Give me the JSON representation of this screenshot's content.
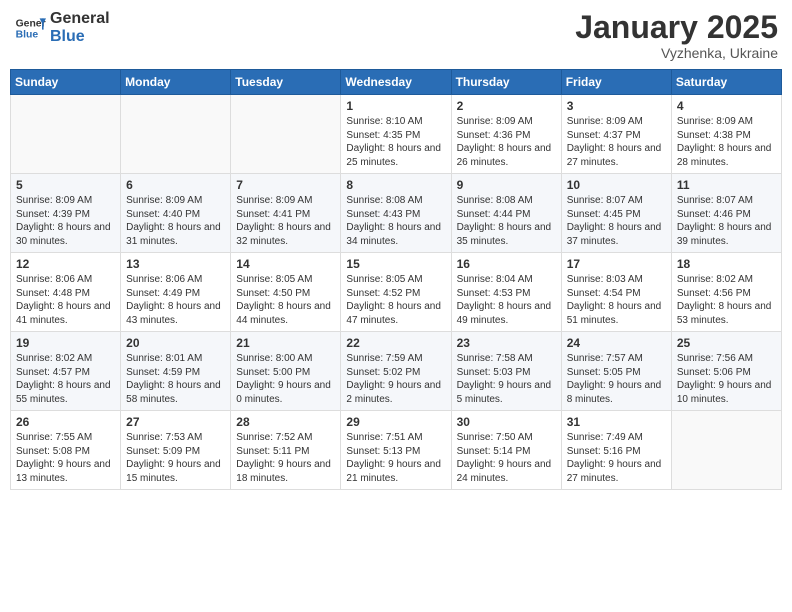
{
  "logo": {
    "line1": "General",
    "line2": "Blue"
  },
  "title": "January 2025",
  "subtitle": "Vyzhenka, Ukraine",
  "weekdays": [
    "Sunday",
    "Monday",
    "Tuesday",
    "Wednesday",
    "Thursday",
    "Friday",
    "Saturday"
  ],
  "weeks": [
    [
      {
        "day": "",
        "info": ""
      },
      {
        "day": "",
        "info": ""
      },
      {
        "day": "",
        "info": ""
      },
      {
        "day": "1",
        "info": "Sunrise: 8:10 AM\nSunset: 4:35 PM\nDaylight: 8 hours and 25 minutes."
      },
      {
        "day": "2",
        "info": "Sunrise: 8:09 AM\nSunset: 4:36 PM\nDaylight: 8 hours and 26 minutes."
      },
      {
        "day": "3",
        "info": "Sunrise: 8:09 AM\nSunset: 4:37 PM\nDaylight: 8 hours and 27 minutes."
      },
      {
        "day": "4",
        "info": "Sunrise: 8:09 AM\nSunset: 4:38 PM\nDaylight: 8 hours and 28 minutes."
      }
    ],
    [
      {
        "day": "5",
        "info": "Sunrise: 8:09 AM\nSunset: 4:39 PM\nDaylight: 8 hours and 30 minutes."
      },
      {
        "day": "6",
        "info": "Sunrise: 8:09 AM\nSunset: 4:40 PM\nDaylight: 8 hours and 31 minutes."
      },
      {
        "day": "7",
        "info": "Sunrise: 8:09 AM\nSunset: 4:41 PM\nDaylight: 8 hours and 32 minutes."
      },
      {
        "day": "8",
        "info": "Sunrise: 8:08 AM\nSunset: 4:43 PM\nDaylight: 8 hours and 34 minutes."
      },
      {
        "day": "9",
        "info": "Sunrise: 8:08 AM\nSunset: 4:44 PM\nDaylight: 8 hours and 35 minutes."
      },
      {
        "day": "10",
        "info": "Sunrise: 8:07 AM\nSunset: 4:45 PM\nDaylight: 8 hours and 37 minutes."
      },
      {
        "day": "11",
        "info": "Sunrise: 8:07 AM\nSunset: 4:46 PM\nDaylight: 8 hours and 39 minutes."
      }
    ],
    [
      {
        "day": "12",
        "info": "Sunrise: 8:06 AM\nSunset: 4:48 PM\nDaylight: 8 hours and 41 minutes."
      },
      {
        "day": "13",
        "info": "Sunrise: 8:06 AM\nSunset: 4:49 PM\nDaylight: 8 hours and 43 minutes."
      },
      {
        "day": "14",
        "info": "Sunrise: 8:05 AM\nSunset: 4:50 PM\nDaylight: 8 hours and 44 minutes."
      },
      {
        "day": "15",
        "info": "Sunrise: 8:05 AM\nSunset: 4:52 PM\nDaylight: 8 hours and 47 minutes."
      },
      {
        "day": "16",
        "info": "Sunrise: 8:04 AM\nSunset: 4:53 PM\nDaylight: 8 hours and 49 minutes."
      },
      {
        "day": "17",
        "info": "Sunrise: 8:03 AM\nSunset: 4:54 PM\nDaylight: 8 hours and 51 minutes."
      },
      {
        "day": "18",
        "info": "Sunrise: 8:02 AM\nSunset: 4:56 PM\nDaylight: 8 hours and 53 minutes."
      }
    ],
    [
      {
        "day": "19",
        "info": "Sunrise: 8:02 AM\nSunset: 4:57 PM\nDaylight: 8 hours and 55 minutes."
      },
      {
        "day": "20",
        "info": "Sunrise: 8:01 AM\nSunset: 4:59 PM\nDaylight: 8 hours and 58 minutes."
      },
      {
        "day": "21",
        "info": "Sunrise: 8:00 AM\nSunset: 5:00 PM\nDaylight: 9 hours and 0 minutes."
      },
      {
        "day": "22",
        "info": "Sunrise: 7:59 AM\nSunset: 5:02 PM\nDaylight: 9 hours and 2 minutes."
      },
      {
        "day": "23",
        "info": "Sunrise: 7:58 AM\nSunset: 5:03 PM\nDaylight: 9 hours and 5 minutes."
      },
      {
        "day": "24",
        "info": "Sunrise: 7:57 AM\nSunset: 5:05 PM\nDaylight: 9 hours and 8 minutes."
      },
      {
        "day": "25",
        "info": "Sunrise: 7:56 AM\nSunset: 5:06 PM\nDaylight: 9 hours and 10 minutes."
      }
    ],
    [
      {
        "day": "26",
        "info": "Sunrise: 7:55 AM\nSunset: 5:08 PM\nDaylight: 9 hours and 13 minutes."
      },
      {
        "day": "27",
        "info": "Sunrise: 7:53 AM\nSunset: 5:09 PM\nDaylight: 9 hours and 15 minutes."
      },
      {
        "day": "28",
        "info": "Sunrise: 7:52 AM\nSunset: 5:11 PM\nDaylight: 9 hours and 18 minutes."
      },
      {
        "day": "29",
        "info": "Sunrise: 7:51 AM\nSunset: 5:13 PM\nDaylight: 9 hours and 21 minutes."
      },
      {
        "day": "30",
        "info": "Sunrise: 7:50 AM\nSunset: 5:14 PM\nDaylight: 9 hours and 24 minutes."
      },
      {
        "day": "31",
        "info": "Sunrise: 7:49 AM\nSunset: 5:16 PM\nDaylight: 9 hours and 27 minutes."
      },
      {
        "day": "",
        "info": ""
      }
    ]
  ]
}
